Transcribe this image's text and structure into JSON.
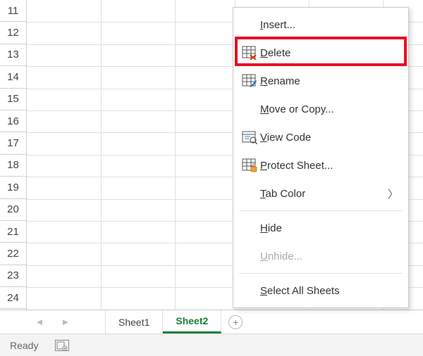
{
  "rows": [
    "11",
    "12",
    "13",
    "14",
    "15",
    "16",
    "17",
    "18",
    "19",
    "20",
    "21",
    "22",
    "23",
    "24"
  ],
  "tabs": {
    "prev_icon": "◄",
    "next_icon": "►",
    "items": [
      "Sheet1",
      "Sheet2"
    ],
    "active_index": 1,
    "new_sheet_glyph": "+"
  },
  "status": {
    "ready": "Ready"
  },
  "context_menu": {
    "insert": "Insert...",
    "delete": "Delete",
    "rename": "Rename",
    "move_copy": "Move or Copy...",
    "view_code": "View Code",
    "protect": "Protect Sheet...",
    "tab_color": "Tab Color",
    "hide": "Hide",
    "unhide": "Unhide...",
    "select_all": "Select All Sheets",
    "chevron": "〉"
  }
}
